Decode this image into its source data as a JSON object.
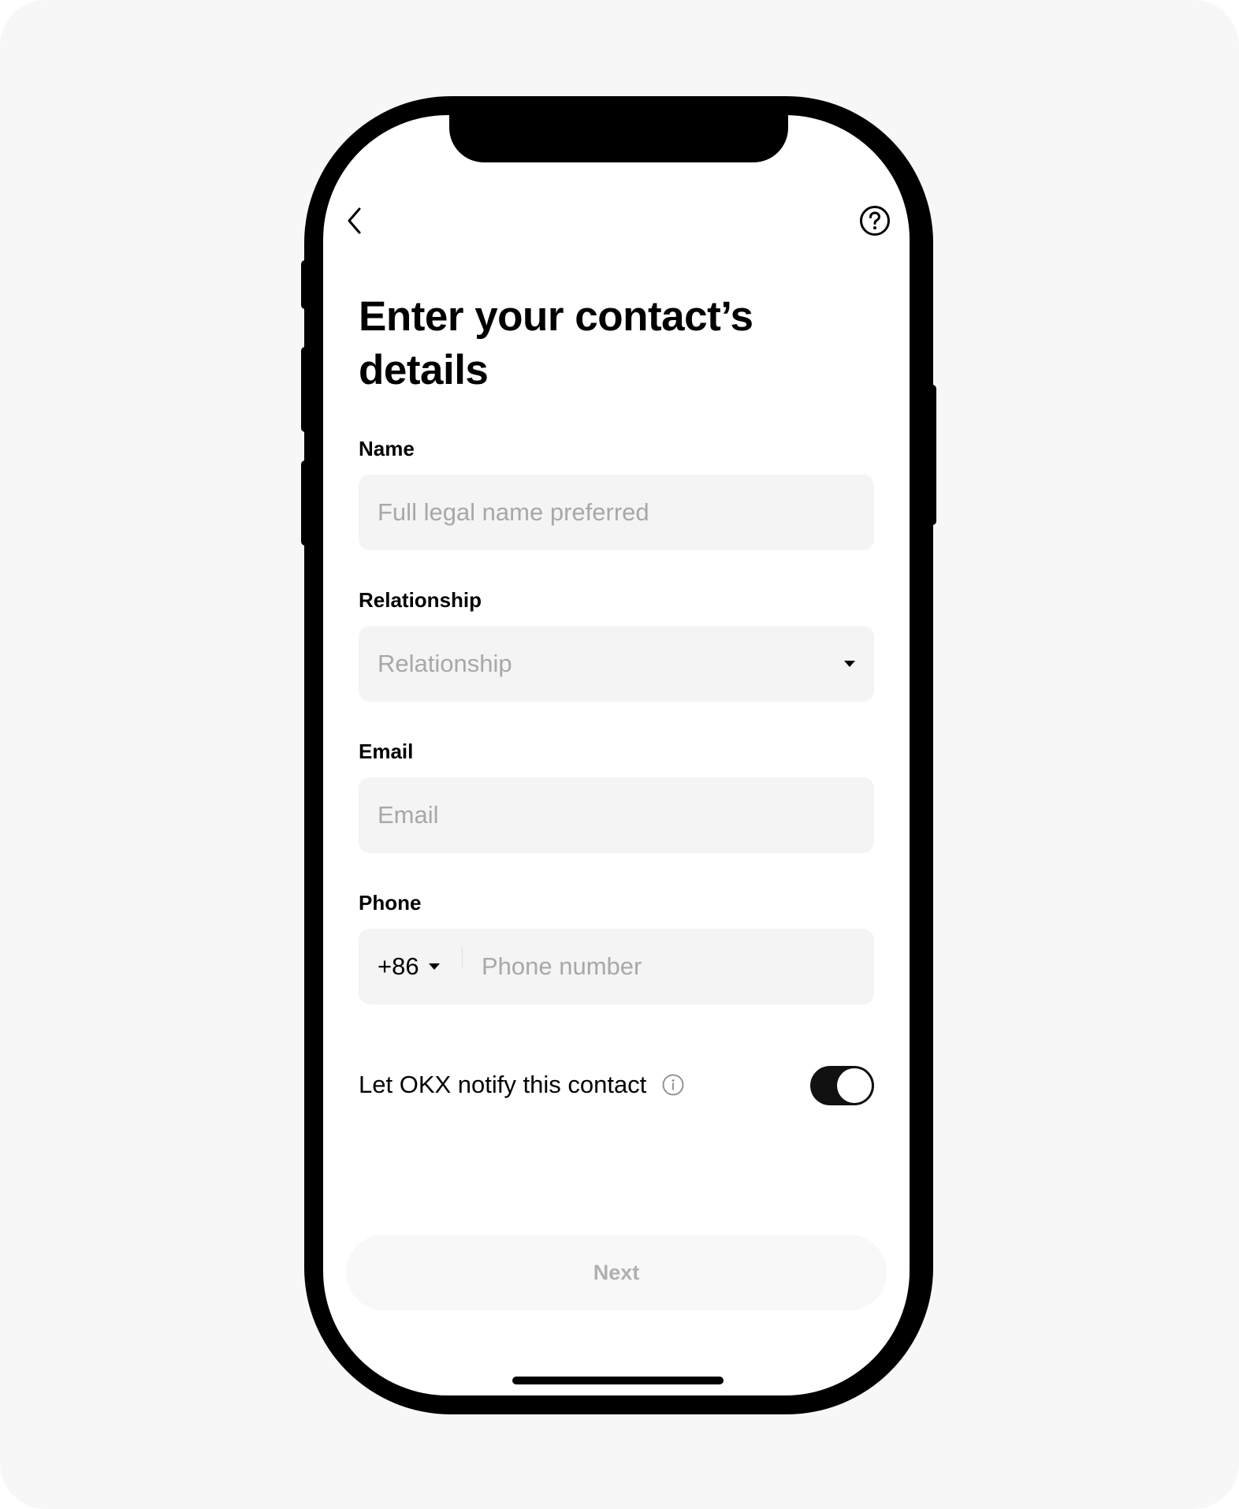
{
  "header": {
    "back_icon": "chevron-left-icon",
    "help_icon": "question-circle-icon"
  },
  "page": {
    "title": "Enter your contact’s details"
  },
  "form": {
    "name": {
      "label": "Name",
      "placeholder": "Full legal name preferred",
      "value": ""
    },
    "relationship": {
      "label": "Relationship",
      "placeholder": "Relationship",
      "selected": ""
    },
    "email": {
      "label": "Email",
      "placeholder": "Email",
      "value": ""
    },
    "phone": {
      "label": "Phone",
      "country_code": "+86",
      "placeholder": "Phone number",
      "value": ""
    },
    "notify": {
      "label": "Let OKX notify this contact",
      "enabled": true
    }
  },
  "footer": {
    "next_label": "Next"
  },
  "colors": {
    "background": "#f7f7f7",
    "phone_frame": "#000000",
    "field_bg": "#f4f4f4",
    "placeholder": "#a8a8a8",
    "toggle_on": "#111111",
    "button_disabled_bg": "#f8f8f8",
    "button_disabled_text": "#b0b0b0"
  }
}
